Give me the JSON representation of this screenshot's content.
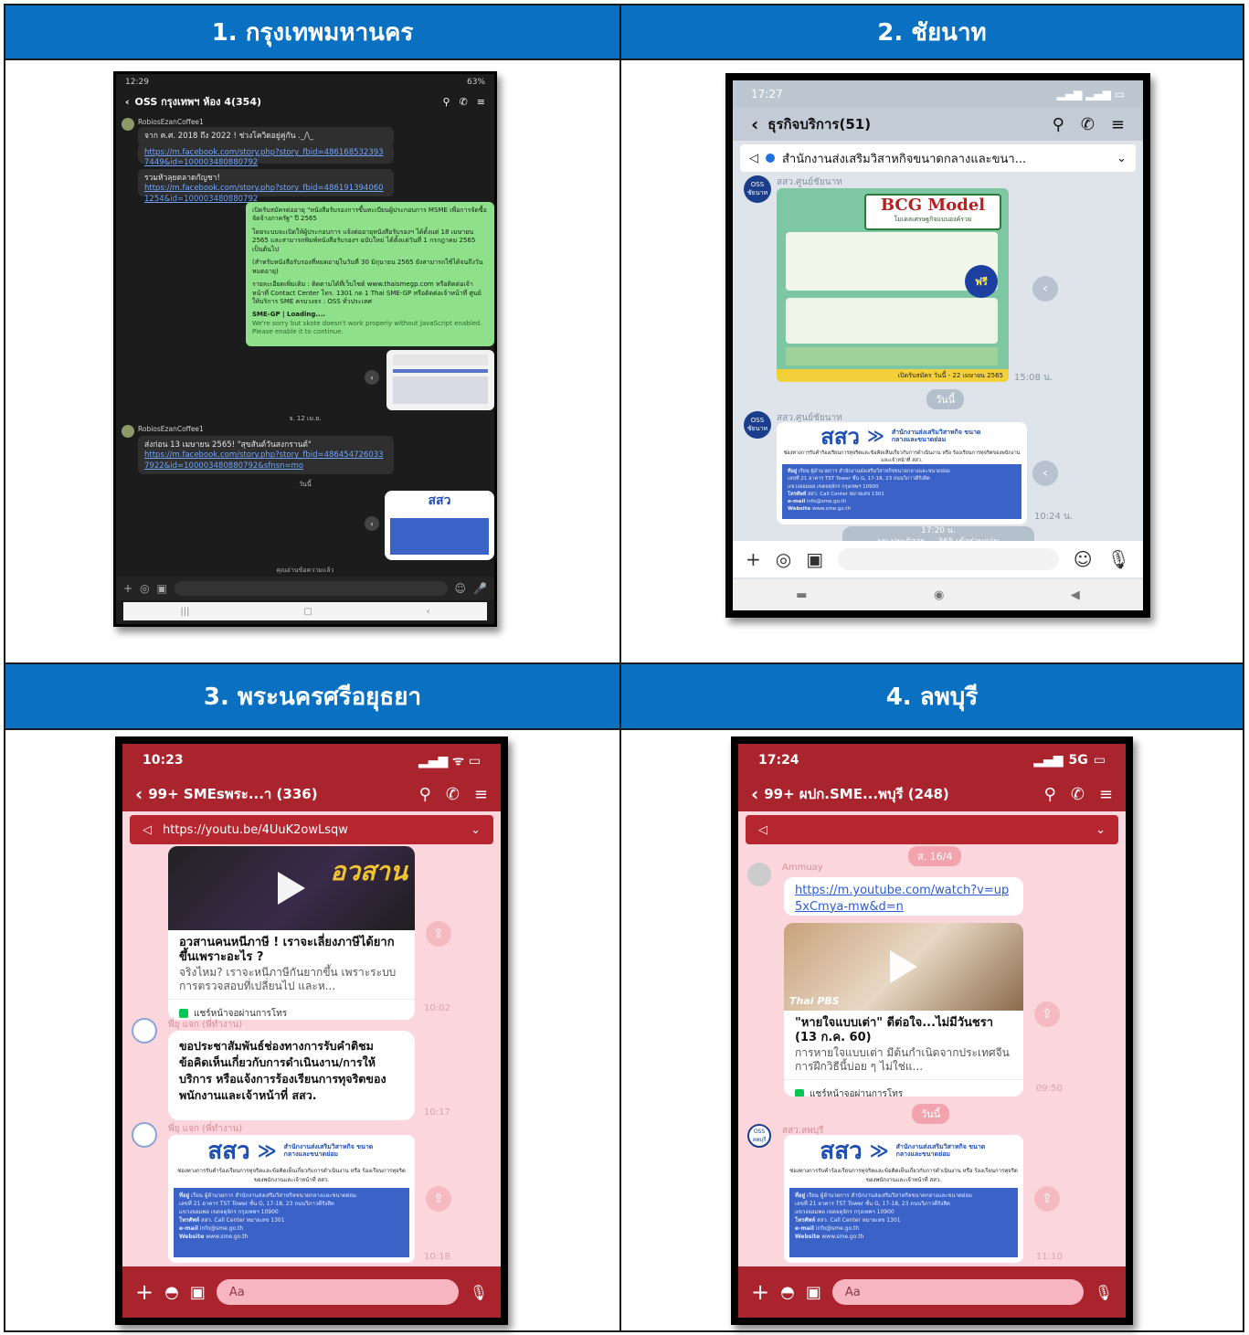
{
  "headers": [
    "1. กรุงเทพมหานคร",
    "2. ชัยนาท",
    "3. พระนครศรีอยุธยา",
    "4. ลพบุรี"
  ],
  "p1": {
    "status_time": "12:29",
    "status_right": "63%",
    "chat_title": "OSS กรุงเทพฯ ห้อง 4(354)",
    "sender1": "RobiosEzanCoffee1",
    "msg1_text": "จาก ค.ศ. 2018 ถึง 2022 ! ช่วงโควิดอยู่คู่กัน ._/\\_",
    "msg1_link": "https://m.facebook.com/story.php?story_fbid=4861685323937449&id=100003480880792",
    "msg2_text": "รวมหัวลุยตลาดกัญชา!",
    "msg2_link": "https://m.facebook.com/story.php?story_fbid=4861913940601254&id=100003480880792",
    "green_lines": [
      "เปิดรับสมัครต่ออายุ \"หนังสือรับรองการขึ้นทะเบียนผู้ประกอบการ MSME เพื่อการจัดซื้อจัดจ้างภาครัฐ\" ปี 2565",
      "โดยระบบจะเปิดให้ผู้ประกอบการ แจ้งต่ออายุหนังสือรับรองฯ ได้ตั้งแต่ 18 เมษายน 2565 และสามารถพิมพ์หนังสือรับรองฯ ฉบับใหม่ ได้ตั้งแต่วันที่ 1 กรกฎาคม 2565 เป็นต้นไป",
      "(สำหรับหนังสือรับรองที่หมดอายุในวันที่ 30 มิถุนายน 2565 ยังสามารถใช้ได้จนถึงวันหมดอายุ)",
      "รายละเอียดเพิ่มเติม : ติดตามได้ที่เว็บไซต์ www.thaismegp.com หรือติดต่อเจ้าหน้าที่ Contact Center โทร. 1301 กด 1 Thai SME-GP หรือติดต่อเจ้าหน้าที่ ศูนย์ให้บริการ SME ครบวงจร : OSS ทั่วประเทศ",
      "SME-GP | Loading....",
      "We're sorry but skote doesn't work properly without JavaScript enabled. Please enable it to continue."
    ],
    "date_pill": "จ. 12 เม.ย.",
    "sender2": "RobiosEzanCoffee1",
    "msg3_text": "ส่งก่อน 13 เมษายน 2565! \"สุขสันต์วันสงกรานต์\"",
    "msg3_link": "https://m.facebook.com/story.php?story_fbid=4864547260337922&id=100003480880792&sfnsn=mo",
    "today": "วันนี้",
    "sme_logo": "สสว",
    "unread": "คุณอ่านข้อความแล้ว"
  },
  "p2": {
    "status_time": "17:27",
    "chat_title": "ธุรกิจบริการ(51)",
    "announcement": "สำนักงานส่งเสริมวิสาหกิจขนาดกลางและขนา...",
    "avatar_label": "OSS ชัยนาท",
    "sender": "สสว.ศูนย์ชัยนาท",
    "bcg_title": "BCG Model",
    "bcg_sub": "โมเดลเศรษฐกิจแบบองค์รวม",
    "bcg_free": "ฟรี",
    "bcg_footer": "เปิดรับสมัคร วันนี้ - 22 เมษายน 2565",
    "time1": "15:08 น.",
    "today": "วันนี้",
    "sender2": "สสว.ศูนย์ชัยนาท",
    "sme_logo": "สสว",
    "sme_org": "สำนักงานส่งเสริมวิสาหกิจ ขนาดกลางและขนาดย่อม",
    "sme_desc": "ช่องทางการรับคำร้องเรียนการทุจริตและข้อคิดเห็นเกี่ยวกับการดำเนินงาน หรือ ร้องเรียนการทุจริตของพนักงานและเจ้าหน้าที่ สสว.",
    "time2": "10:24 น.",
    "system_time": "17:20 น.",
    "system_msg": "บูม ประภัสสร ... 365 เข้าร่วมกลุ่ม"
  },
  "p3": {
    "status_time": "10:23",
    "chat_title": "99+ SMEsพระ...า (336)",
    "announcement": "https://youtu.be/4UuK2owLsqw",
    "yt_title": "อวสานคนหนีภาษี ! เราจะเลี่ยงภาษีได้ยากขึ้นเพราะอะไร ?",
    "yt_sub": "จริงไหม? เราจะหนีภาษีกันยากขึ้น เพราะระบบการตรวจสอบที่เปลี่ยนไป และห...",
    "yt_foot": "แชร์หน้าจอผ่านการโทร",
    "time1": "10:02",
    "sender": "พี่ยุ แจก (พี่ทำงาน)",
    "msg": "ขอประชาสัมพันธ์ช่องทางการรับคำติชม ข้อคิดเห็นเกี่ยวกับการดำเนินงาน/การให้บริการ หรือแจ้งการร้องเรียนการทุจริตของพนักงานและเจ้าหน้าที่ สสว.",
    "time2": "10:17",
    "sender2": "พี่ยุ แจก (พี่ทำงาน)",
    "sme_logo": "สสว",
    "sme_org": "สำนักงานส่งเสริมวิสาหกิจ ขนาดกลางและขนาดย่อม",
    "time3": "10:18",
    "input_placeholder": "Aa"
  },
  "p4": {
    "status_time": "17:24",
    "status_net": "5G",
    "chat_title": "99+ ผปก.SME...พบุรี (248)",
    "date_pill": "ส. 16/4",
    "sender": "Ammuay",
    "link": "https://m.youtube.com/watch?v=up5xCmya-mw&d=n",
    "channel": "Thai PBS",
    "yt_title": "\"หายใจแบบเต่า\" ดีต่อใจ...ไม่มีวันชรา (13 ก.ค. 60)",
    "yt_sub": "การหายใจแบบเต่า มีต้นกำเนิดจากประเทศจีน การฝึกวิธีนี้บ่อย ๆ ไม่ใช่แ...",
    "yt_foot": "แชร์หน้าจอผ่านการโทร",
    "time1": "09:50",
    "today": "วันนี้",
    "sender2": "สสว.ลพบุรี",
    "avatar_label": "OSS ลพบุรี",
    "sme_logo": "สสว",
    "sme_org": "สำนักงานส่งเสริมวิสาหกิจ ขนาดกลางและขนาดย่อม",
    "time2": "11:10",
    "input_placeholder": "Aa"
  },
  "sme_rows": [
    [
      "ที่อยู่",
      "เรียน ผู้อำนวยการ สำนักงานส่งเสริมวิสาหกิจขนาดกลางและขนาดย่อม"
    ],
    [
      "",
      "เลขที่ 21 อาคาร TST Tower ชั้น G, 17-18, 23 ถนนวิภาวดีรังสิต"
    ],
    [
      "",
      "แขวงจอมพล เขตจตุจักร กรุงเทพฯ 10900"
    ],
    [
      "โทรศัพท์",
      "สสว. Call Center หมายเลข 1301"
    ],
    [
      "e-mail",
      "info@sme.go.th"
    ],
    [
      "Website",
      "www.sme.go.th"
    ]
  ],
  "colors": {
    "header_blue": "#0a71c2",
    "line_red": "#a9242d",
    "pink_bg": "#fbd6dc",
    "sme_blue": "#3a62c7"
  }
}
